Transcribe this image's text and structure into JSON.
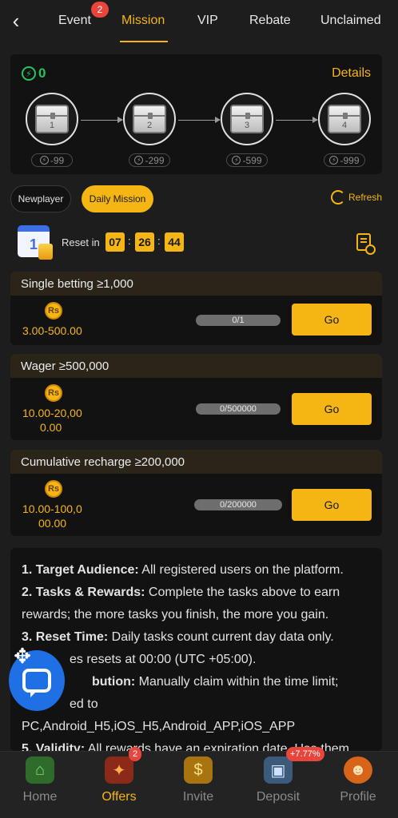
{
  "nav": {
    "back_icon": "chevron-left-icon",
    "tabs": [
      {
        "label": "Event",
        "badge": "2"
      },
      {
        "label": "Mission",
        "active": true
      },
      {
        "label": "VIP"
      },
      {
        "label": "Rebate"
      },
      {
        "label": "Unclaimed"
      }
    ]
  },
  "progress_panel": {
    "energy_value": "0",
    "details_label": "Details",
    "chests": [
      {
        "number": "1",
        "cost": "-99"
      },
      {
        "number": "2",
        "cost": "-299"
      },
      {
        "number": "3",
        "cost": "-599"
      },
      {
        "number": "4",
        "cost": "-999"
      }
    ]
  },
  "mission_tabs": {
    "newplayer_label": "Newplayer",
    "daily_label": "Daily Mission",
    "refresh_label": "Refresh"
  },
  "reset": {
    "label": "Reset in",
    "hours": "07",
    "minutes": "26",
    "seconds": "44",
    "calendar_day": "1"
  },
  "tasks": [
    {
      "title": "Single betting ≥1,000",
      "coin": "Rs",
      "reward_line1": "3.00-500.00",
      "reward_line2": "",
      "progress": "0/1",
      "go_label": "Go"
    },
    {
      "title": "Wager ≥500,000",
      "coin": "Rs",
      "reward_line1": "10.00-20,00",
      "reward_line2": "0.00",
      "progress": "0/500000",
      "go_label": "Go"
    },
    {
      "title": "Cumulative recharge ≥200,000",
      "coin": "Rs",
      "reward_line1": "10.00-100,0",
      "reward_line2": "00.00",
      "progress": "0/200000",
      "go_label": "Go"
    }
  ],
  "rules": {
    "r1_head": "1. Target Audience:",
    "r1_text": " All registered users on the platform.",
    "r2_head": "2. Tasks & Rewards:",
    "r2_text": " Complete the tasks above to earn rewards; the more tasks you finish, the more you gain.",
    "r3_head": "3. Reset Time:",
    "r3_text": " Daily tasks count current day data only.",
    "r3_line2": "es resets at 00:00 (UTC +05:00).",
    "r4_head": "bution:",
    "r4_text": " Manually claim within the time limit;",
    "r4_line2": "ed to",
    "r4_line3": "PC,Android_H5,iOS_H5,Android_APP,iOS_APP",
    "r5_head": "5. Validity:",
    "r5_text": " All rewards have an expiration date. Use them"
  },
  "bottom_nav": [
    {
      "label": "Home",
      "icon": "home-icon"
    },
    {
      "label": "Offers",
      "icon": "gift-icon",
      "badge": "2",
      "active": true
    },
    {
      "label": "Invite",
      "icon": "money-bag-icon"
    },
    {
      "label": "Deposit",
      "icon": "wallet-icon",
      "badge": "+7.77%"
    },
    {
      "label": "Profile",
      "icon": "profile-icon"
    }
  ],
  "colors": {
    "accent": "#f5b614",
    "background": "#1d1d1d",
    "panel": "#121212",
    "energy_green": "#22c55e",
    "badge_red": "#e8453c",
    "chat_blue": "#1f6fe5"
  }
}
